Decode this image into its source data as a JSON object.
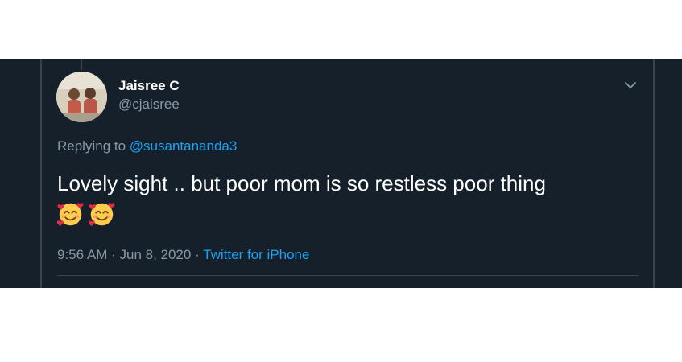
{
  "tweet": {
    "author": {
      "display_name": "Jaisree C",
      "handle": "@cjaisree"
    },
    "reply_prefix": "Replying to ",
    "reply_to_handle": "@susantananda3",
    "text": "Lovely sight .. but poor mom is so restless poor thing",
    "emojis": [
      "smiling-face-with-hearts-icon",
      "smiling-face-with-hearts-icon"
    ],
    "time": "9:56 AM",
    "separator": " · ",
    "date": "Jun 8, 2020",
    "source": "Twitter for iPhone"
  },
  "colors": {
    "panel_background": "#15202b",
    "primary_text": "#ffffff",
    "secondary_text": "#8899a6",
    "accent": "#1da1f2",
    "divider": "#38444d"
  }
}
